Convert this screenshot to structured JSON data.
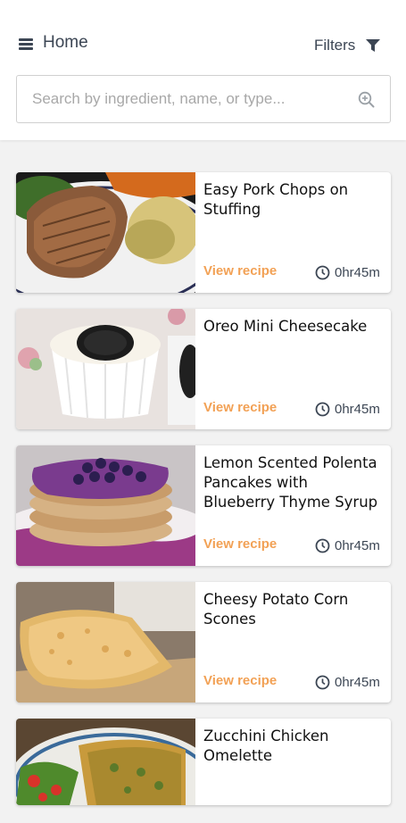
{
  "header": {
    "title": "Home",
    "filters_label": "Filters",
    "menu_icon": "hamburger-menu-icon",
    "filter_icon": "funnel-icon"
  },
  "search": {
    "placeholder": "Search by ingredient, name, or type...",
    "value": "",
    "icon": "zoom-search-icon"
  },
  "colors": {
    "accent": "#f2a155",
    "text_dark": "#3c4654",
    "background": "#f2f2f2"
  },
  "recipes": [
    {
      "title": "Easy Pork Chops on Stuffing",
      "link_label": "View recipe",
      "time": "0hr45m",
      "image": "pork-chops-photo"
    },
    {
      "title": "Oreo Mini Cheesecake",
      "link_label": "View recipe",
      "time": "0hr45m",
      "image": "oreo-cheesecake-photo"
    },
    {
      "title": "Lemon Scented Polenta Pancakes with Blueberry Thyme Syrup",
      "link_label": "View recipe",
      "time": "0hr45m",
      "image": "blueberry-pancakes-photo"
    },
    {
      "title": "Cheesy Potato Corn Scones",
      "link_label": "View recipe",
      "time": "0hr45m",
      "image": "corn-scones-photo"
    },
    {
      "title": "Zucchini Chicken Omelette",
      "link_label": "",
      "time": "",
      "image": "omelette-photo"
    }
  ]
}
